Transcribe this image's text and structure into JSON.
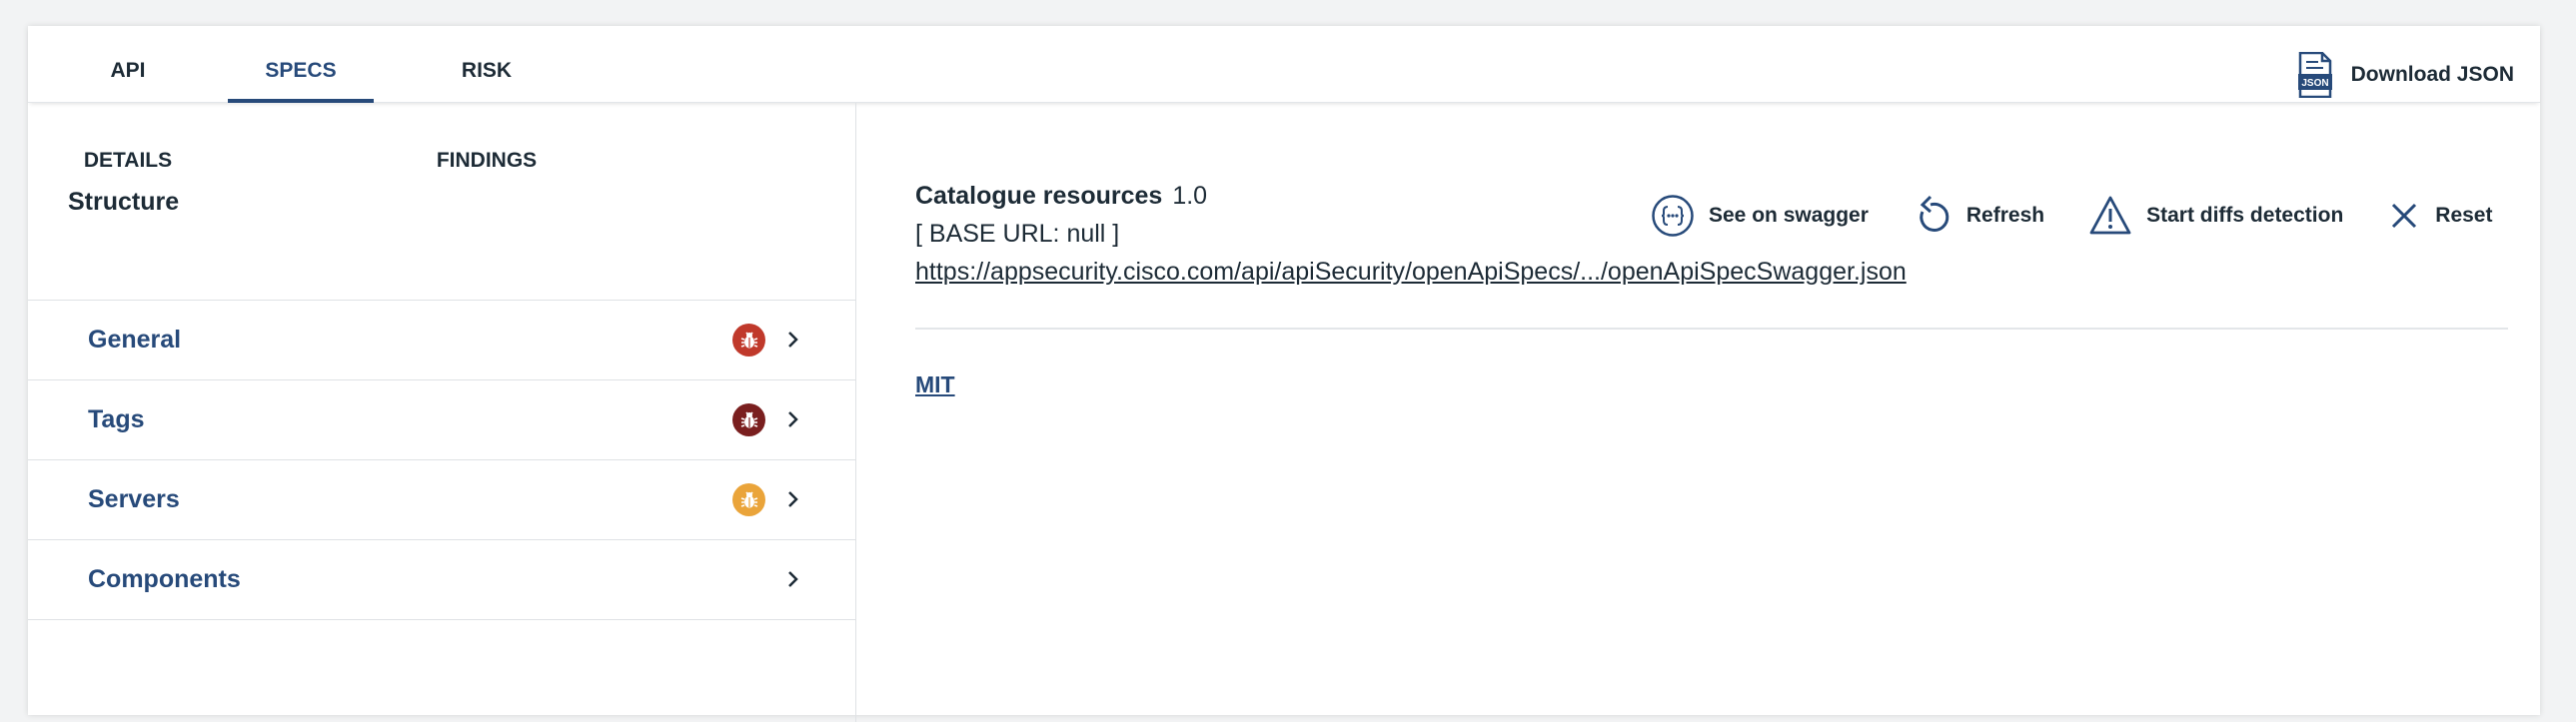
{
  "tabs": [
    {
      "label": "API DETAILS",
      "active": false
    },
    {
      "label": "SPECS",
      "active": true
    },
    {
      "label": "RISK FINDINGS",
      "active": false
    }
  ],
  "download": {
    "label": "Download JSON",
    "icon": "json-file-icon",
    "icon_text": "JSON"
  },
  "structure": {
    "title": "Structure",
    "items": [
      {
        "label": "General",
        "badge_color": "#c0392b",
        "badge_icon": "bug-icon"
      },
      {
        "label": "Tags",
        "badge_color": "#7a1f1f",
        "badge_icon": "bug-icon"
      },
      {
        "label": "Servers",
        "badge_color": "#eaa43a",
        "badge_icon": "bug-icon"
      },
      {
        "label": "Components",
        "badge_color": null,
        "badge_icon": null
      }
    ]
  },
  "spec": {
    "name": "Catalogue resources",
    "version": "1.0",
    "base_url": "[ BASE URL: null ]",
    "link": "https://appsecurity.cisco.com/api/apiSecurity/openApiSpecs/.../openApiSpecSwagger.json",
    "license": "MIT"
  },
  "actions": [
    {
      "label": "See on swagger",
      "icon": "swagger-icon"
    },
    {
      "label": "Refresh",
      "icon": "refresh-icon"
    },
    {
      "label": "Start diffs detection",
      "icon": "warning-icon"
    },
    {
      "label": "Reset",
      "icon": "close-icon"
    }
  ],
  "colors": {
    "accent": "#274a7a",
    "text": "#1d2b36",
    "badge_critical": "#c0392b",
    "badge_high": "#7a1f1f",
    "badge_medium": "#eaa43a"
  }
}
